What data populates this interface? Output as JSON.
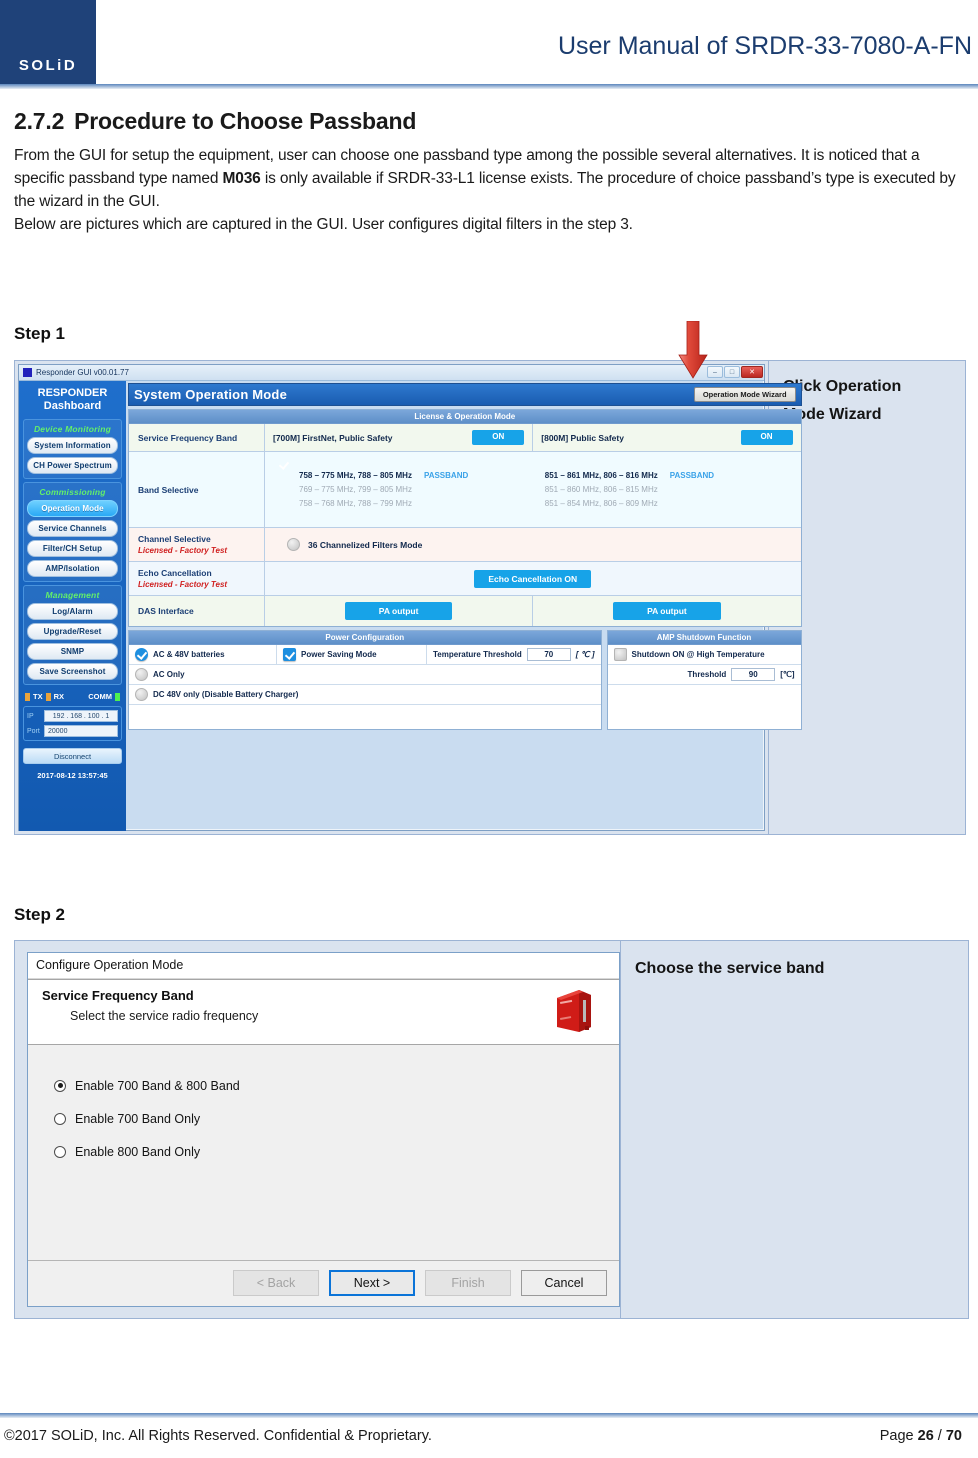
{
  "header": {
    "logo_text": "SOLiD",
    "title": "User Manual of SRDR-33-7080-A-FN"
  },
  "section": {
    "number": "2.7.2",
    "heading": "Procedure to Choose Passband",
    "paragraph1_a": "From the GUI for setup the equipment, user can choose one passband type among the possible several alternatives. It is noticed that a specific passband type named ",
    "paragraph1_bold": "M036",
    "paragraph1_b": " is only available if SRDR-33-L1 license exists. The procedure of choice passband’s type is executed by the wizard in the GUI.",
    "paragraph2": "Below are pictures which are captured in the GUI. User configures digital filters in the step 3."
  },
  "step1": {
    "label": "Step 1",
    "caption_line1": "Click     Operation",
    "caption_line2": "Mode Wizard",
    "window_title": "Responder GUI v00.01.77",
    "win_minimize": "–",
    "win_maximize": "□",
    "win_close": "✕",
    "sidebar": {
      "title_line1": "RESPONDER",
      "title_line2": "Dashboard",
      "groups": [
        {
          "head": "Device Monitoring",
          "items": [
            "System Information",
            "CH Power Spectrum"
          ]
        },
        {
          "head": "Commissioning",
          "items": [
            "Operation Mode",
            "Service Channels",
            "Filter/CH Setup",
            "AMP/Isolation"
          ]
        },
        {
          "head": "Management",
          "items": [
            "Log/Alarm",
            "Upgrade/Reset",
            "SNMP",
            "Save Screenshot"
          ]
        }
      ],
      "active_item": "Operation Mode",
      "status": {
        "tx": "TX",
        "rx": "RX",
        "comm": "COMM"
      },
      "ip_label": "IP",
      "ip_value": "192 . 168 . 100 .  1",
      "port_label": "Port",
      "port_value": "20000",
      "disconnect": "Disconnect",
      "timestamp": "2017-08-12 13:57:45"
    },
    "main": {
      "title": "System Operation Mode",
      "wizard_button": "Operation Mode Wizard",
      "panel_head": "License & Operation Mode",
      "rows": {
        "service_frequency_band": {
          "label": "Service Frequency Band",
          "band700_name": "[700M] FirstNet, Public Safety",
          "band700_state": "ON",
          "band800_name": "[800M] Public Safety",
          "band800_state": "ON"
        },
        "band_selective": {
          "label": "Band Selective",
          "passband_tag": "PASSBAND",
          "lines_700": [
            "758 – 775 MHz, 788 – 805 MHz",
            "769 – 775 MHz, 799 – 805 MHz",
            "758 – 768 MHz, 788 – 799 MHz"
          ],
          "lines_800": [
            "851 – 861 MHz, 806 – 816 MHz",
            "851 – 860 MHz, 806 – 815 MHz",
            "851 – 854 MHz, 806 – 809 MHz"
          ]
        },
        "channel_selective": {
          "label": "Channel Selective",
          "sub": "Licensed - Factory Test",
          "value": "36 Channelized Filters Mode"
        },
        "echo_cancellation": {
          "label": "Echo Cancellation",
          "sub": "Licensed - Factory Test",
          "button": "Echo Cancellation ON"
        },
        "das_interface": {
          "label": "DAS Interface",
          "left_button": "PA output",
          "right_button": "PA output"
        }
      },
      "power_configuration": {
        "head": "Power Configuration",
        "ac_48v": "AC & 48V batteries",
        "power_saving": "Power Saving Mode",
        "temp_threshold_label": "Temperature Threshold",
        "temp_threshold_value": "70",
        "temp_unit": "[ ℃ ]",
        "ac_only": "AC Only",
        "dc_48v": "DC 48V only (Disable Battery Charger)"
      },
      "amp_shutdown": {
        "head": "AMP Shutdown Function",
        "shutdown_label": "Shutdown ON @ High Temperature",
        "threshold_label": "Threshold",
        "threshold_value": "90",
        "threshold_unit": "[℃]"
      }
    }
  },
  "step2": {
    "label": "Step 2",
    "caption": "Choose the service band",
    "dialog": {
      "title": "Configure Operation Mode",
      "banner_title": "Service Frequency Band",
      "banner_sub": "Select the service radio frequency",
      "options": [
        "Enable 700 Band & 800 Band",
        "Enable 700 Band Only",
        "Enable 800 Band Only"
      ],
      "selected_option": 0,
      "buttons": {
        "back": "< Back",
        "next": "Next >",
        "finish": "Finish",
        "cancel": "Cancel"
      }
    }
  },
  "footer": {
    "copyright": "©2017 SOLiD, Inc. All Rights Reserved. Confidential & Proprietary.",
    "page_prefix": "Page ",
    "page_current": "26",
    "page_sep": " / ",
    "page_total": "70"
  },
  "colors": {
    "brand_navy": "#1f4279",
    "accent_blue": "#17a3e8",
    "caption_bg": "#dae3ef",
    "arrow_red": "#d42e1e"
  }
}
